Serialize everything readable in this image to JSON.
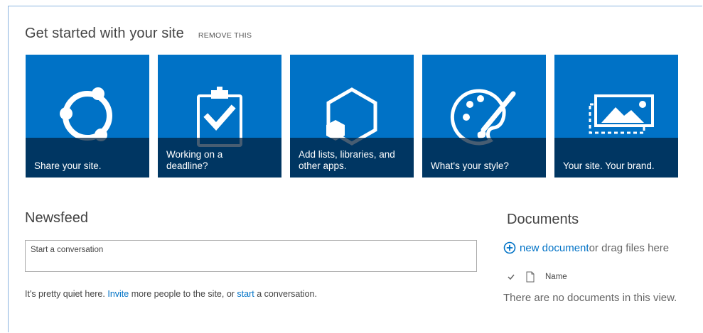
{
  "get_started": {
    "title": "Get started with your site",
    "remove_label": "REMOVE THIS",
    "tiles": [
      {
        "icon": "share-icon",
        "caption": "Share your site."
      },
      {
        "icon": "clipboard-check-icon",
        "caption": "Working on a\ndeadline?"
      },
      {
        "icon": "apps-hexagon-icon",
        "caption": "Add lists, libraries, and\nother apps."
      },
      {
        "icon": "palette-brush-icon",
        "caption": "What's your style?"
      },
      {
        "icon": "picture-frame-icon",
        "caption": "Your site. Your brand."
      }
    ]
  },
  "newsfeed": {
    "title": "Newsfeed",
    "input_placeholder": "Start a conversation",
    "message_prefix": "It's pretty quiet here. ",
    "invite_link": "Invite",
    "message_middle": " more people to the site, or ",
    "start_link": "start",
    "message_suffix": " a conversation."
  },
  "documents": {
    "title": "Documents",
    "new_document_link": "new document",
    "drag_text": " or drag files here",
    "column_name": "Name",
    "empty_message": "There are no documents in this view."
  },
  "colors": {
    "tile_blue": "#0072c6",
    "caption_overlay": "#001e3c",
    "link_blue": "#0072c6"
  }
}
